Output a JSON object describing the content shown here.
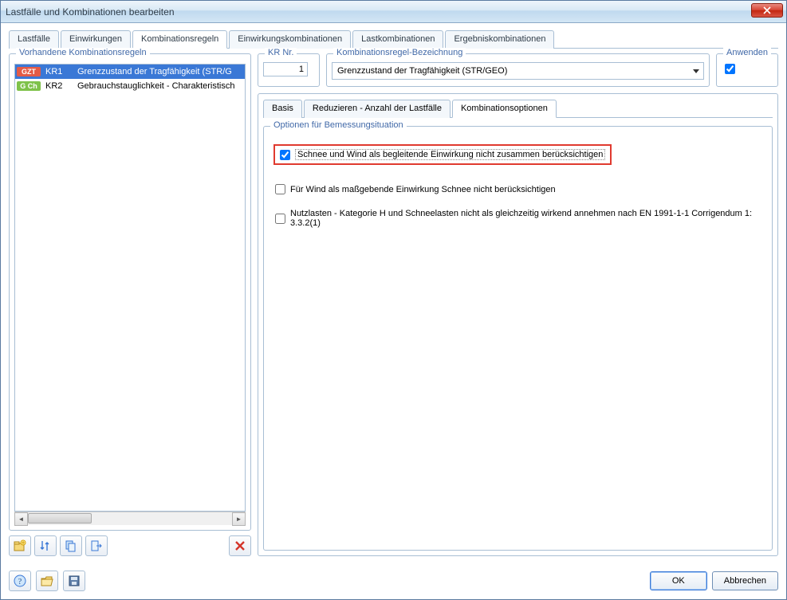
{
  "window": {
    "title": "Lastfälle und Kombinationen bearbeiten"
  },
  "main_tabs": {
    "t0": "Lastfälle",
    "t1": "Einwirkungen",
    "t2": "Kombinationsregeln",
    "t3": "Einwirkungskombinationen",
    "t4": "Lastkombinationen",
    "t5": "Ergebniskombinationen",
    "active": "t2"
  },
  "left": {
    "title": "Vorhandene Kombinationsregeln",
    "rows": [
      {
        "badge": "GZT",
        "badge_style": "red",
        "code": "KR1",
        "desc": "Grenzzustand der Tragfähigkeit (STR/G",
        "selected": true
      },
      {
        "badge": "G Ch",
        "badge_style": "green",
        "code": "KR2",
        "desc": "Gebrauchstauglichkeit - Charakteristisch",
        "selected": false
      }
    ]
  },
  "fields": {
    "krnr_label": "KR Nr.",
    "krnr_value": "1",
    "krbez_label": "Kombinationsregel-Bezeichnung",
    "krbez_value": "Grenzzustand der Tragfähigkeit (STR/GEO)",
    "anwenden_label": "Anwenden",
    "anwenden_checked": true
  },
  "subtabs": {
    "s0": "Basis",
    "s1": "Reduzieren - Anzahl der Lastfälle",
    "s2": "Kombinationsoptionen",
    "active": "s2"
  },
  "options": {
    "group_label": "Optionen für Bemessungsituation",
    "o1": {
      "label": "Schnee und Wind als begleitende Einwirkung nicht zusammen berücksichtigen",
      "checked": true
    },
    "o2": {
      "label": "Für Wind als maßgebende Einwirkung Schnee nicht berücksichtigen",
      "checked": false
    },
    "o3": {
      "label": "Nutzlasten - Kategorie H und Schneelasten nicht als gleichzeitig wirkend annehmen nach EN 1991-1-1 Corrigendum 1: 3.3.2(1)",
      "checked": false
    }
  },
  "buttons": {
    "ok": "OK",
    "cancel": "Abbrechen"
  }
}
